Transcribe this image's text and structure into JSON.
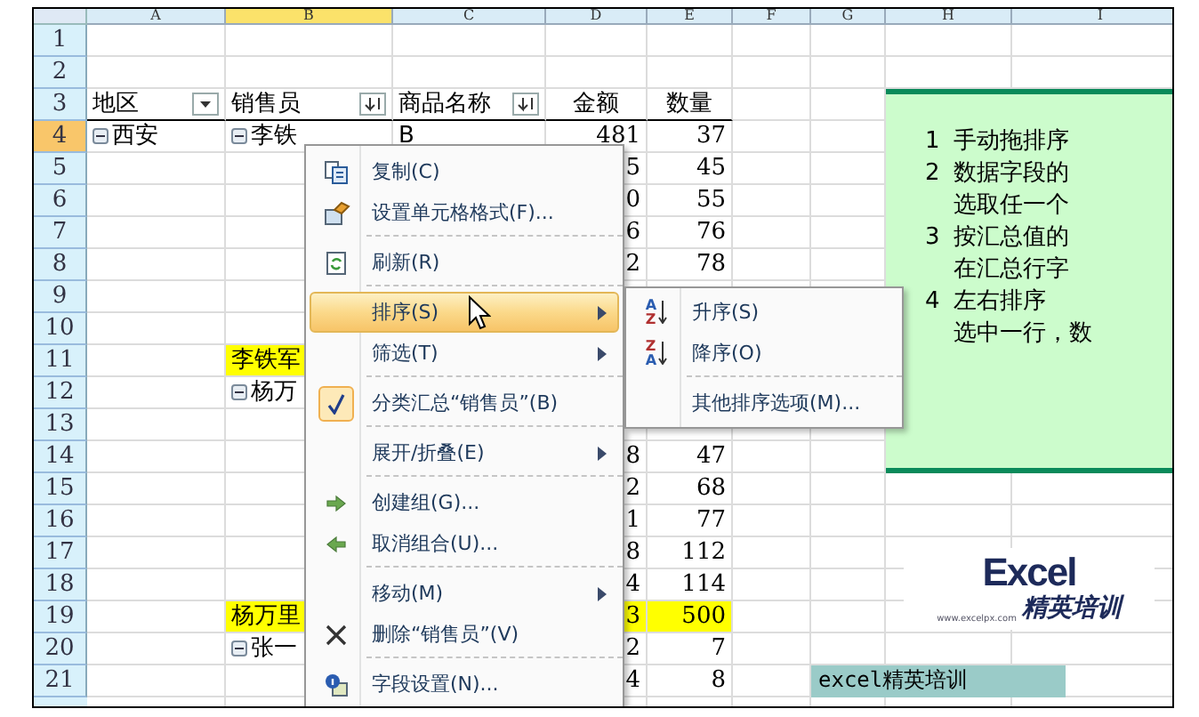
{
  "columns": [
    {
      "label": "A",
      "selected": false
    },
    {
      "label": "B",
      "selected": true
    },
    {
      "label": "C",
      "selected": false
    },
    {
      "label": "D",
      "selected": false
    },
    {
      "label": "E",
      "selected": false
    },
    {
      "label": "F",
      "selected": false
    },
    {
      "label": "G",
      "selected": false
    },
    {
      "label": "H",
      "selected": false
    },
    {
      "label": "I",
      "selected": false
    }
  ],
  "rows": [
    {
      "label": "1",
      "selected": false
    },
    {
      "label": "2",
      "selected": false
    },
    {
      "label": "3",
      "selected": false,
      "cells": {
        "A": {
          "kind": "dropdown_header",
          "text": "地区"
        },
        "B": {
          "kind": "sort_header",
          "text": "销售员"
        },
        "C": {
          "kind": "sort_header",
          "text": "商品名称"
        },
        "D": {
          "kind": "label",
          "text": "金额"
        },
        "E": {
          "kind": "label",
          "text": "数量"
        }
      }
    },
    {
      "label": "4",
      "selected": true,
      "cells": {
        "A": {
          "kind": "group",
          "text": "西安"
        },
        "B": {
          "kind": "group",
          "text": "李铁"
        },
        "C": {
          "kind": "text",
          "text": "B",
          "highlight": false
        },
        "D": {
          "kind": "number",
          "text": "481",
          "highlight": false
        },
        "E": {
          "kind": "number",
          "text": "37",
          "highlight": false
        }
      }
    },
    {
      "label": "5",
      "selected": false,
      "cells": {
        "D": {
          "kind": "number",
          "text": "5",
          "highlight": false
        },
        "E": {
          "kind": "number",
          "text": "45",
          "highlight": false
        }
      }
    },
    {
      "label": "6",
      "selected": false,
      "cells": {
        "D": {
          "kind": "number",
          "text": "0",
          "highlight": false
        },
        "E": {
          "kind": "number",
          "text": "55",
          "highlight": false
        }
      }
    },
    {
      "label": "7",
      "selected": false,
      "cells": {
        "D": {
          "kind": "number",
          "text": "6",
          "highlight": false
        },
        "E": {
          "kind": "number",
          "text": "76",
          "highlight": false
        }
      }
    },
    {
      "label": "8",
      "selected": false,
      "cells": {
        "D": {
          "kind": "number",
          "text": "2",
          "highlight": false
        },
        "E": {
          "kind": "number",
          "text": "78",
          "highlight": false
        }
      }
    },
    {
      "label": "9",
      "selected": false
    },
    {
      "label": "10",
      "selected": false
    },
    {
      "label": "11",
      "selected": false,
      "cells": {
        "B": {
          "kind": "text",
          "text": "李铁军",
          "highlight": true
        }
      }
    },
    {
      "label": "12",
      "selected": false,
      "cells": {
        "B": {
          "kind": "group",
          "text": "杨万"
        }
      }
    },
    {
      "label": "13",
      "selected": false
    },
    {
      "label": "14",
      "selected": false,
      "cells": {
        "D": {
          "kind": "number",
          "text": "8",
          "highlight": false
        },
        "E": {
          "kind": "number",
          "text": "47",
          "highlight": false
        }
      }
    },
    {
      "label": "15",
      "selected": false,
      "cells": {
        "D": {
          "kind": "number",
          "text": "2",
          "highlight": false
        },
        "E": {
          "kind": "number",
          "text": "68",
          "highlight": false
        }
      }
    },
    {
      "label": "16",
      "selected": false,
      "cells": {
        "D": {
          "kind": "number",
          "text": "1",
          "highlight": false
        },
        "E": {
          "kind": "number",
          "text": "77",
          "highlight": false
        }
      }
    },
    {
      "label": "17",
      "selected": false,
      "cells": {
        "D": {
          "kind": "number",
          "text": "8",
          "highlight": false
        },
        "E": {
          "kind": "number",
          "text": "112",
          "highlight": false
        }
      }
    },
    {
      "label": "18",
      "selected": false,
      "cells": {
        "D": {
          "kind": "number",
          "text": "4",
          "highlight": false
        },
        "E": {
          "kind": "number",
          "text": "114",
          "highlight": false
        }
      }
    },
    {
      "label": "19",
      "selected": false,
      "cells": {
        "B": {
          "kind": "text",
          "text": "杨万里",
          "highlight": true
        },
        "D": {
          "kind": "number",
          "text": "3",
          "highlight": true
        },
        "E": {
          "kind": "number",
          "text": "500",
          "highlight": true
        }
      }
    },
    {
      "label": "20",
      "selected": false,
      "cells": {
        "B": {
          "kind": "group",
          "text": "张一"
        },
        "D": {
          "kind": "number",
          "text": "2",
          "highlight": false
        },
        "E": {
          "kind": "number",
          "text": "7",
          "highlight": false
        }
      }
    },
    {
      "label": "21",
      "selected": false,
      "cells": {
        "D": {
          "kind": "number",
          "text": "4",
          "highlight": false
        },
        "E": {
          "kind": "number",
          "text": "8",
          "highlight": false
        }
      }
    }
  ],
  "note": {
    "lines": [
      {
        "num": "1",
        "text": "手动拖排序"
      },
      {
        "num": "2",
        "text": "数据字段的"
      },
      {
        "text": "选取任一个"
      },
      {
        "num": "3",
        "text": "按汇总值的"
      },
      {
        "text": "在汇总行字"
      },
      {
        "num": "4",
        "text": "左右排序"
      },
      {
        "text": "选中一行，数"
      }
    ]
  },
  "logo": {
    "word": "Excel",
    "subtitle": "精英培训",
    "url": "www.excelpx.com"
  },
  "banner": {
    "text": "excel精英培训"
  },
  "context_menu": {
    "items": [
      {
        "kind": "item",
        "label": "复制(C)",
        "submenu": false,
        "selected": false
      },
      {
        "kind": "item",
        "label": "设置单元格格式(F)...",
        "submenu": false,
        "selected": false
      },
      {
        "kind": "separator"
      },
      {
        "kind": "item",
        "label": "刷新(R)",
        "submenu": false,
        "selected": false
      },
      {
        "kind": "separator"
      },
      {
        "kind": "item",
        "label": "排序(S)",
        "submenu": true,
        "selected": true
      },
      {
        "kind": "item",
        "label": "筛选(T)",
        "submenu": true,
        "selected": false
      },
      {
        "kind": "separator"
      },
      {
        "kind": "check",
        "label": "分类汇总“销售员”(B)",
        "checked": true
      },
      {
        "kind": "separator"
      },
      {
        "kind": "item",
        "label": "展开/折叠(E)",
        "submenu": true,
        "selected": false
      },
      {
        "kind": "separator"
      },
      {
        "kind": "item",
        "label": "创建组(G)...",
        "submenu": false,
        "selected": false
      },
      {
        "kind": "item",
        "label": "取消组合(U)...",
        "submenu": false,
        "selected": false
      },
      {
        "kind": "separator"
      },
      {
        "kind": "item",
        "label": "移动(M)",
        "submenu": true,
        "selected": false
      },
      {
        "kind": "item",
        "label": "删除“销售员”(V)",
        "submenu": false,
        "selected": false
      },
      {
        "kind": "separator"
      },
      {
        "kind": "item",
        "label": "字段设置(N)...",
        "submenu": false,
        "selected": false
      }
    ]
  },
  "submenu": {
    "items": [
      {
        "kind": "item",
        "label": "升序(S)",
        "letters": [
          "A",
          "Z"
        ],
        "selected": false
      },
      {
        "kind": "item",
        "label": "降序(O)",
        "letters": [
          "Z",
          "A"
        ],
        "selected": false
      },
      {
        "kind": "separator"
      },
      {
        "kind": "item",
        "label": "其他排序选项(M)...",
        "selected": false
      }
    ]
  }
}
